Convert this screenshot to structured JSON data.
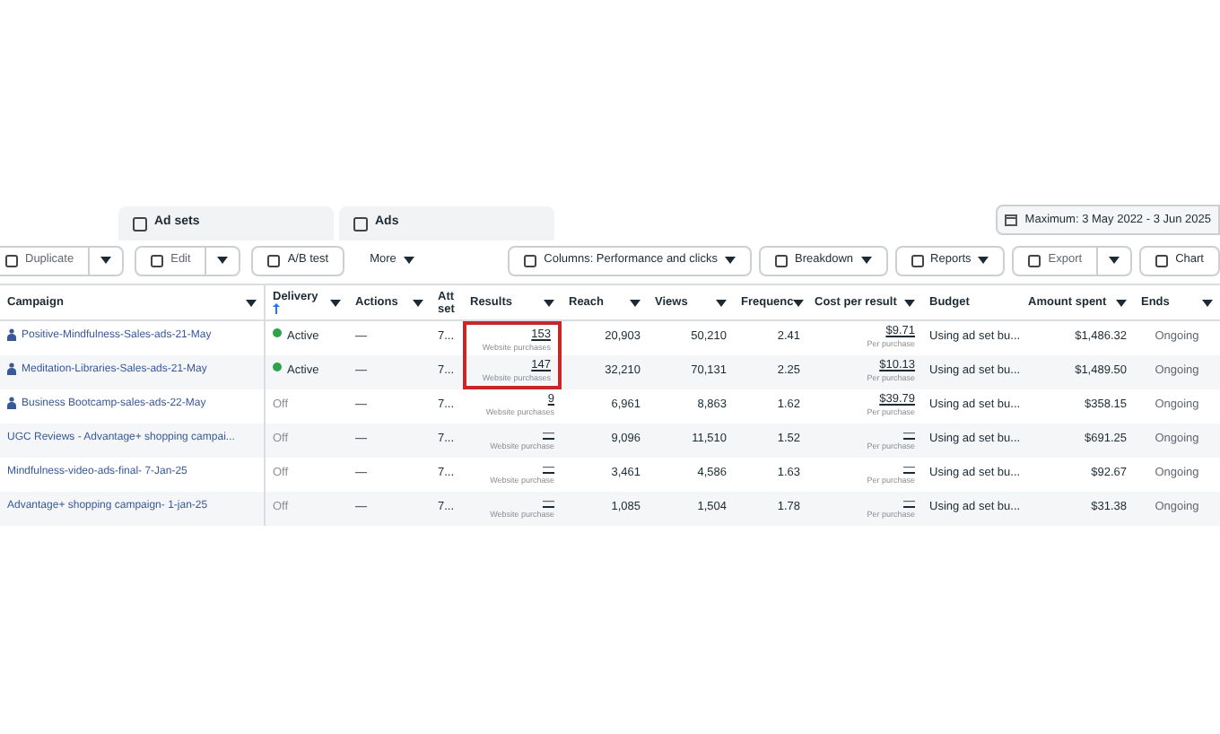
{
  "tabs": [
    {
      "label": "Ad sets",
      "selected": false
    },
    {
      "label": "Ads",
      "selected": false
    }
  ],
  "date_range": "Maximum: 3 May 2022 - 3 Jun 2025",
  "toolbar_left": [
    {
      "label": "Duplicate",
      "kind": "split"
    },
    {
      "label": "Edit",
      "kind": "split"
    },
    {
      "label": "A/B test",
      "kind": "button"
    },
    {
      "label": "More",
      "kind": "menu"
    }
  ],
  "toolbar_right": [
    {
      "label": "Columns: Performance and clicks",
      "kind": "menu"
    },
    {
      "label": "Breakdown",
      "kind": "menu"
    },
    {
      "label": "Reports",
      "kind": "menu"
    },
    {
      "label": "Export",
      "kind": "split"
    },
    {
      "label": "Chart",
      "kind": "button"
    }
  ],
  "columns": [
    {
      "label": "Campaign",
      "sort": false
    },
    {
      "label": "Delivery",
      "sort": true
    },
    {
      "label": "Actions",
      "sort": false
    },
    {
      "label": "Att set",
      "sort": false
    },
    {
      "label": "Results",
      "sort": false
    },
    {
      "label": "Reach",
      "sort": false
    },
    {
      "label": "Views",
      "sort": false
    },
    {
      "label": "Frequenc",
      "sort": false
    },
    {
      "label": "Cost per result",
      "sort": false
    },
    {
      "label": "Budget",
      "sort": false
    },
    {
      "label": "Amount spent",
      "sort": false
    },
    {
      "label": "Ends",
      "sort": false
    }
  ],
  "rows": [
    {
      "campaign": "Positive-Mindfulness-Sales-ads-21-May",
      "has_icon": true,
      "delivery": "Active",
      "active": true,
      "actions": "—",
      "att": "7...",
      "results": "153",
      "results_sub": "Website purchases",
      "highlighted": true,
      "reach": "20,903",
      "views": "50,210",
      "frequency": "2.41",
      "cost": "$9.71",
      "cost_sub": "Per purchase",
      "budget": "Using ad set bu...",
      "spent": "$1,486.32",
      "ends": "Ongoing"
    },
    {
      "campaign": "Meditation-Libraries-Sales-ads-21-May",
      "has_icon": true,
      "delivery": "Active",
      "active": true,
      "actions": "—",
      "att": "7...",
      "results": "147",
      "results_sub": "Website purchases",
      "highlighted": true,
      "reach": "32,210",
      "views": "70,131",
      "frequency": "2.25",
      "cost": "$10.13",
      "cost_sub": "Per purchase",
      "budget": "Using ad set bu...",
      "spent": "$1,489.50",
      "ends": "Ongoing"
    },
    {
      "campaign": "Business Bootcamp-sales-ads-22-May",
      "has_icon": true,
      "delivery": "Off",
      "active": false,
      "actions": "—",
      "att": "7...",
      "results": "9",
      "results_sub": "Website purchases",
      "highlighted": false,
      "reach": "6,961",
      "views": "8,863",
      "frequency": "1.62",
      "cost": "$39.79",
      "cost_sub": "Per purchase",
      "budget": "Using ad set bu...",
      "spent": "$358.15",
      "ends": "Ongoing"
    },
    {
      "campaign": "UGC Reviews - Advantage+ shopping campai...",
      "has_icon": false,
      "delivery": "Off",
      "active": false,
      "actions": "—",
      "att": "7...",
      "results": "—",
      "results_sub": "Website purchase",
      "highlighted": false,
      "reach": "9,096",
      "views": "11,510",
      "frequency": "1.52",
      "cost": "—",
      "cost_sub": "Per purchase",
      "budget": "Using ad set bu...",
      "spent": "$691.25",
      "ends": "Ongoing"
    },
    {
      "campaign": "Mindfulness-video-ads-final- 7-Jan-25",
      "has_icon": false,
      "delivery": "Off",
      "active": false,
      "actions": "—",
      "att": "7...",
      "results": "—",
      "results_sub": "Website purchase",
      "highlighted": false,
      "reach": "3,461",
      "views": "4,586",
      "frequency": "1.63",
      "cost": "—",
      "cost_sub": "Per purchase",
      "budget": "Using ad set bu...",
      "spent": "$92.67",
      "ends": "Ongoing"
    },
    {
      "campaign": "Advantage+ shopping campaign- 1-jan-25",
      "has_icon": false,
      "delivery": "Off",
      "active": false,
      "actions": "—",
      "att": "7...",
      "results": "—",
      "results_sub": "Website purchase",
      "highlighted": false,
      "reach": "1,085",
      "views": "1,504",
      "frequency": "1.78",
      "cost": "—",
      "cost_sub": "Per purchase",
      "budget": "Using ad set bu...",
      "spent": "$31.38",
      "ends": "Ongoing"
    }
  ]
}
